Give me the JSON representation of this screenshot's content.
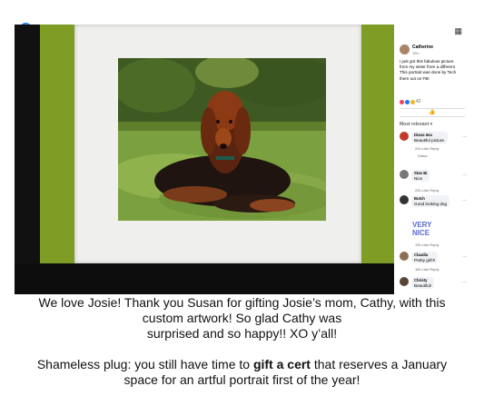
{
  "facebook": {
    "badge": "f",
    "grid_icon": "▦",
    "post": {
      "author": "Catherine",
      "meta": "19h · ",
      "text_lines": [
        "I just got this fabulous picture",
        "from my sister from a different",
        "This portrait was done by Tech",
        "them out on FB!"
      ],
      "reaction_count": "42",
      "like_icon": "thumbs-up-icon"
    },
    "most_relevant": "Most relevant ▾",
    "comments": [
      {
        "name": "Diana Ima",
        "text": "Beautiful picture.",
        "meta": "20h  Like  Reply",
        "reply": "Diana"
      },
      {
        "name": "Stan Bi",
        "text": "Nice",
        "meta": "20h  Like  Reply"
      },
      {
        "name": "Butch",
        "text": "Good looking dog",
        "meta": ""
      },
      {
        "name": "",
        "text": "",
        "meta": "19h  Like  Reply",
        "sticker": "VERY NICE"
      },
      {
        "name": "Claudia",
        "text": "Pretty girl!!!",
        "meta": "18h  Like  Reply"
      },
      {
        "name": "Christy",
        "text": "Beautiful!",
        "meta": ""
      }
    ]
  },
  "caption": {
    "line1": "We love Josie!  Thank you Susan for gifting Josie’s mom, Cathy, with this",
    "line2": "custom artwork! So glad Cathy was",
    "line3": "surprised and so happy!! XO y’all!",
    "line4_pre": "Shameless plug: you still have time to ",
    "line4_bold": "gift a cert",
    "line4_post": " that reserves a January",
    "line5": "space for an artful portrait first of the year!"
  },
  "colors": {
    "wall": "#7f9d25",
    "fb_blue": "#1877f2"
  }
}
